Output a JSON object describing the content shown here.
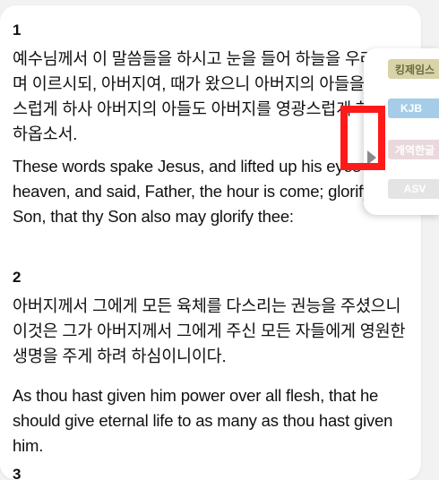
{
  "verses": [
    {
      "number": "1",
      "korean": "예수님께서 이 말씀들을 하시고 눈을 들어 하늘을 우러러보며 이르시되, 아버지여, 때가 왔으니 아버지의 아들을 영광스럽게 하사 아버지의 아들도 아버지를 영광스럽게 하도록 하옵소서.",
      "english": "These words spake Jesus, and lifted up his eyes to heaven, and said, Father, the hour is come; glorify thy Son, that thy Son also may glorify thee:"
    },
    {
      "number": "2",
      "korean": "아버지께서 그에게 모든 육체를 다스리는 권능을 주셨으니 이것은 그가 아버지께서 그에게 주신 모든 자들에게 영원한 생명을 주게 하려 하심이니이다.",
      "english": "As thou hast given him power over all flesh, that he should give eternal life to as many as thou hast given him."
    }
  ],
  "next_verse_number": "3",
  "translation_panel": {
    "tags": [
      "킹제임스",
      "KJB",
      "개역한글",
      "ASV"
    ],
    "toggle_icon": "triangle-right-icon"
  },
  "colors": {
    "highlight_border": "#ff1a1a",
    "king_tag": "#d8d3a9",
    "kjb_tag": "#a6cde8",
    "kr_tag": "#ead9dc",
    "asv_tag": "#e4e4e4"
  }
}
